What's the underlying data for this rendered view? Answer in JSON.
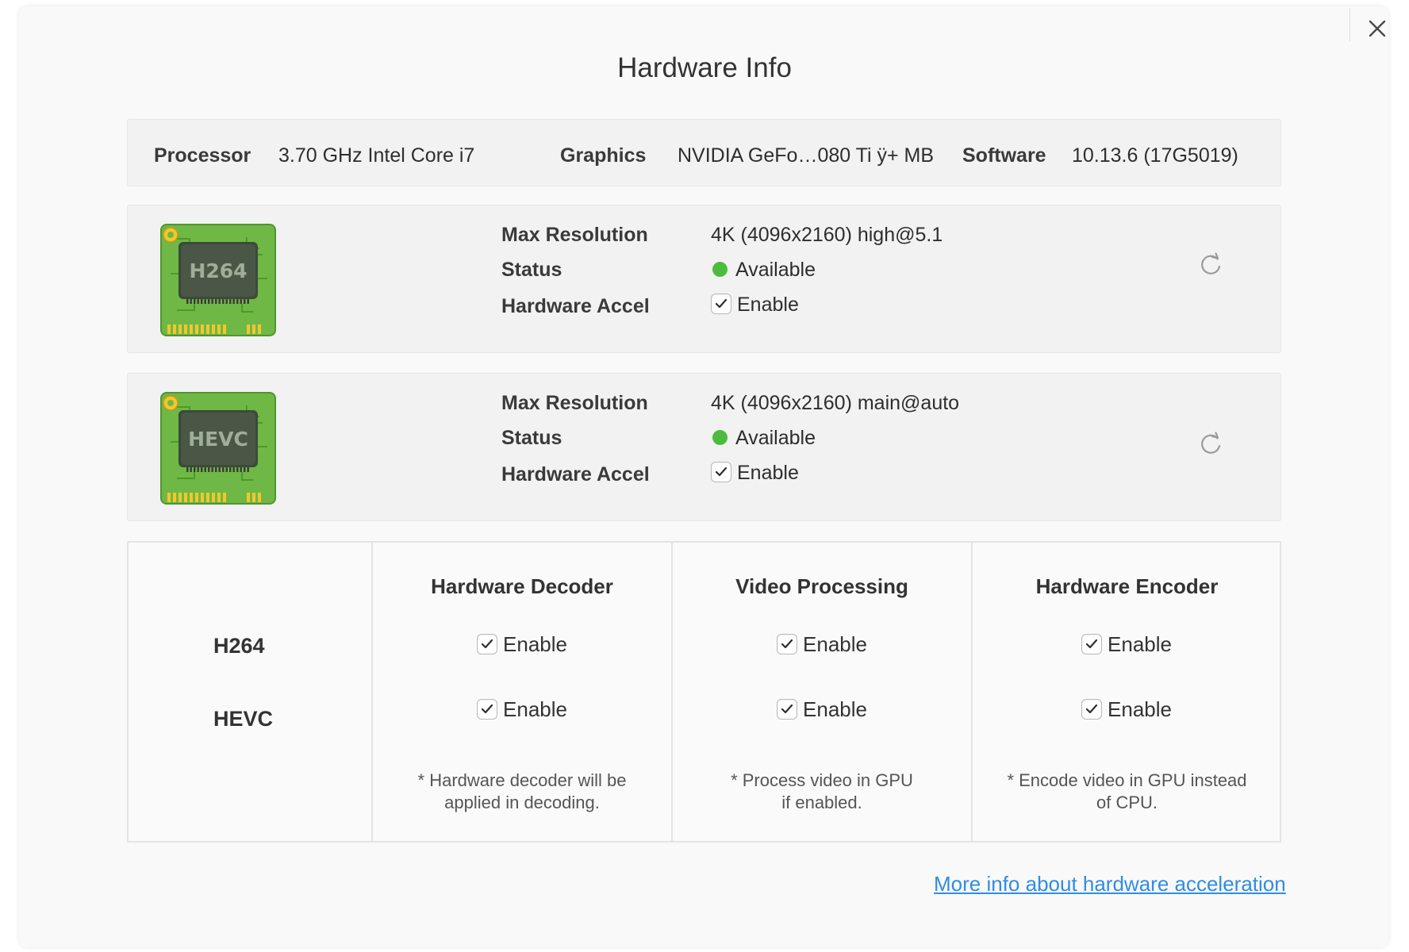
{
  "dialog": {
    "title": "Hardware Info",
    "close_icon": "close-icon"
  },
  "system": {
    "processor_label": "Processor",
    "processor_value": "3.70 GHz Intel Core i7",
    "graphics_label": "Graphics",
    "graphics_value": "NVIDIA GeFo…080 Ti ÿ+ MB",
    "software_label": "Software",
    "software_value": "10.13.6 (17G5019)"
  },
  "codecs": [
    {
      "chip_label": "H264",
      "max_resolution_label": "Max Resolution",
      "max_resolution_value": "4K (4096x2160) high@5.1",
      "status_label": "Status",
      "status_value": "Available",
      "status_color": "#4cbc3f",
      "accel_label": "Hardware Accel",
      "accel_checkbox_label": "Enable",
      "accel_checked": true,
      "refresh_icon": "refresh-icon"
    },
    {
      "chip_label": "HEVC",
      "max_resolution_label": "Max Resolution",
      "max_resolution_value": "4K (4096x2160) main@auto",
      "status_label": "Status",
      "status_value": "Available",
      "status_color": "#4cbc3f",
      "accel_label": "Hardware Accel",
      "accel_checkbox_label": "Enable",
      "accel_checked": true,
      "refresh_icon": "refresh-icon"
    }
  ],
  "matrix": {
    "columns": [
      "Hardware Decoder",
      "Video Processing",
      "Hardware Encoder"
    ],
    "rows": [
      {
        "label": "H264",
        "cells": [
          {
            "label": "Enable",
            "checked": true
          },
          {
            "label": "Enable",
            "checked": true
          },
          {
            "label": "Enable",
            "checked": true
          }
        ]
      },
      {
        "label": "HEVC",
        "cells": [
          {
            "label": "Enable",
            "checked": true
          },
          {
            "label": "Enable",
            "checked": true
          },
          {
            "label": "Enable",
            "checked": true
          }
        ]
      }
    ],
    "notes": [
      {
        "line1": "* Hardware decoder will be",
        "line2": "applied in decoding."
      },
      {
        "line1": "* Process video in GPU",
        "line2": "if enabled."
      },
      {
        "line1": "* Encode video in GPU instead",
        "line2": "of CPU."
      }
    ]
  },
  "footer": {
    "link_text": "More info about hardware acceleration"
  },
  "colors": {
    "accent_link": "#2f8de4",
    "status_available": "#4cbc3f",
    "chip_board": "#6fb845"
  }
}
